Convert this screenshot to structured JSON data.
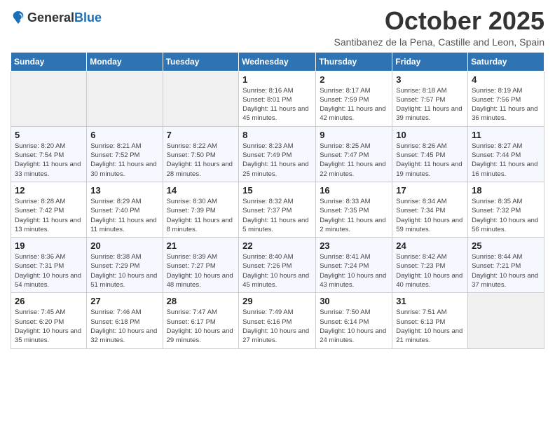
{
  "header": {
    "logo_general": "General",
    "logo_blue": "Blue",
    "month_title": "October 2025",
    "subtitle": "Santibanez de la Pena, Castille and Leon, Spain"
  },
  "days_of_week": [
    "Sunday",
    "Monday",
    "Tuesday",
    "Wednesday",
    "Thursday",
    "Friday",
    "Saturday"
  ],
  "weeks": [
    [
      {
        "day": "",
        "info": ""
      },
      {
        "day": "",
        "info": ""
      },
      {
        "day": "",
        "info": ""
      },
      {
        "day": "1",
        "info": "Sunrise: 8:16 AM\nSunset: 8:01 PM\nDaylight: 11 hours and 45 minutes."
      },
      {
        "day": "2",
        "info": "Sunrise: 8:17 AM\nSunset: 7:59 PM\nDaylight: 11 hours and 42 minutes."
      },
      {
        "day": "3",
        "info": "Sunrise: 8:18 AM\nSunset: 7:57 PM\nDaylight: 11 hours and 39 minutes."
      },
      {
        "day": "4",
        "info": "Sunrise: 8:19 AM\nSunset: 7:56 PM\nDaylight: 11 hours and 36 minutes."
      }
    ],
    [
      {
        "day": "5",
        "info": "Sunrise: 8:20 AM\nSunset: 7:54 PM\nDaylight: 11 hours and 33 minutes."
      },
      {
        "day": "6",
        "info": "Sunrise: 8:21 AM\nSunset: 7:52 PM\nDaylight: 11 hours and 30 minutes."
      },
      {
        "day": "7",
        "info": "Sunrise: 8:22 AM\nSunset: 7:50 PM\nDaylight: 11 hours and 28 minutes."
      },
      {
        "day": "8",
        "info": "Sunrise: 8:23 AM\nSunset: 7:49 PM\nDaylight: 11 hours and 25 minutes."
      },
      {
        "day": "9",
        "info": "Sunrise: 8:25 AM\nSunset: 7:47 PM\nDaylight: 11 hours and 22 minutes."
      },
      {
        "day": "10",
        "info": "Sunrise: 8:26 AM\nSunset: 7:45 PM\nDaylight: 11 hours and 19 minutes."
      },
      {
        "day": "11",
        "info": "Sunrise: 8:27 AM\nSunset: 7:44 PM\nDaylight: 11 hours and 16 minutes."
      }
    ],
    [
      {
        "day": "12",
        "info": "Sunrise: 8:28 AM\nSunset: 7:42 PM\nDaylight: 11 hours and 13 minutes."
      },
      {
        "day": "13",
        "info": "Sunrise: 8:29 AM\nSunset: 7:40 PM\nDaylight: 11 hours and 11 minutes."
      },
      {
        "day": "14",
        "info": "Sunrise: 8:30 AM\nSunset: 7:39 PM\nDaylight: 11 hours and 8 minutes."
      },
      {
        "day": "15",
        "info": "Sunrise: 8:32 AM\nSunset: 7:37 PM\nDaylight: 11 hours and 5 minutes."
      },
      {
        "day": "16",
        "info": "Sunrise: 8:33 AM\nSunset: 7:35 PM\nDaylight: 11 hours and 2 minutes."
      },
      {
        "day": "17",
        "info": "Sunrise: 8:34 AM\nSunset: 7:34 PM\nDaylight: 10 hours and 59 minutes."
      },
      {
        "day": "18",
        "info": "Sunrise: 8:35 AM\nSunset: 7:32 PM\nDaylight: 10 hours and 56 minutes."
      }
    ],
    [
      {
        "day": "19",
        "info": "Sunrise: 8:36 AM\nSunset: 7:31 PM\nDaylight: 10 hours and 54 minutes."
      },
      {
        "day": "20",
        "info": "Sunrise: 8:38 AM\nSunset: 7:29 PM\nDaylight: 10 hours and 51 minutes."
      },
      {
        "day": "21",
        "info": "Sunrise: 8:39 AM\nSunset: 7:27 PM\nDaylight: 10 hours and 48 minutes."
      },
      {
        "day": "22",
        "info": "Sunrise: 8:40 AM\nSunset: 7:26 PM\nDaylight: 10 hours and 45 minutes."
      },
      {
        "day": "23",
        "info": "Sunrise: 8:41 AM\nSunset: 7:24 PM\nDaylight: 10 hours and 43 minutes."
      },
      {
        "day": "24",
        "info": "Sunrise: 8:42 AM\nSunset: 7:23 PM\nDaylight: 10 hours and 40 minutes."
      },
      {
        "day": "25",
        "info": "Sunrise: 8:44 AM\nSunset: 7:21 PM\nDaylight: 10 hours and 37 minutes."
      }
    ],
    [
      {
        "day": "26",
        "info": "Sunrise: 7:45 AM\nSunset: 6:20 PM\nDaylight: 10 hours and 35 minutes."
      },
      {
        "day": "27",
        "info": "Sunrise: 7:46 AM\nSunset: 6:18 PM\nDaylight: 10 hours and 32 minutes."
      },
      {
        "day": "28",
        "info": "Sunrise: 7:47 AM\nSunset: 6:17 PM\nDaylight: 10 hours and 29 minutes."
      },
      {
        "day": "29",
        "info": "Sunrise: 7:49 AM\nSunset: 6:16 PM\nDaylight: 10 hours and 27 minutes."
      },
      {
        "day": "30",
        "info": "Sunrise: 7:50 AM\nSunset: 6:14 PM\nDaylight: 10 hours and 24 minutes."
      },
      {
        "day": "31",
        "info": "Sunrise: 7:51 AM\nSunset: 6:13 PM\nDaylight: 10 hours and 21 minutes."
      },
      {
        "day": "",
        "info": ""
      }
    ]
  ]
}
